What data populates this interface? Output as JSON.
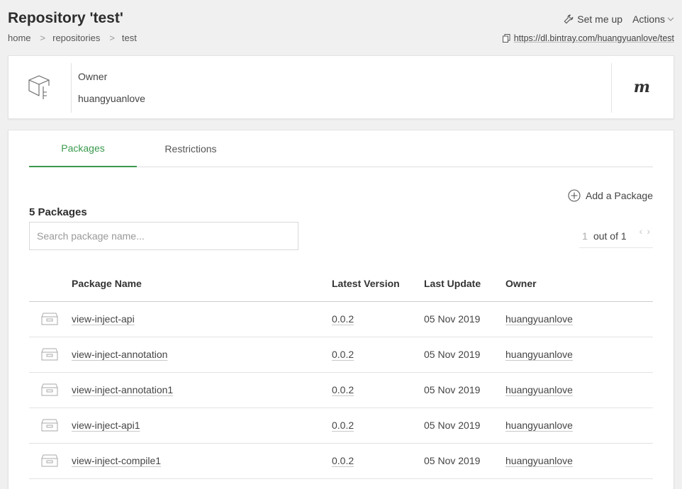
{
  "header": {
    "title": "Repository 'test'",
    "breadcrumb": [
      {
        "label": "home"
      },
      {
        "label": "repositories"
      },
      {
        "label": "test"
      }
    ],
    "breadcrumb_separator": ">",
    "set_me_up_label": "Set me up",
    "actions_label": "Actions",
    "repo_url": "https://dl.bintray.com/huangyuanlove/test"
  },
  "owner_card": {
    "owner_label": "Owner",
    "owner_name": "huangyuanlove",
    "repo_type_logo": "m"
  },
  "tabs": [
    {
      "label": "Packages",
      "active": true
    },
    {
      "label": "Restrictions",
      "active": false
    }
  ],
  "packages": {
    "add_label": "Add a Package",
    "count_label": "5 Packages",
    "search_placeholder": "Search package name...",
    "pager": {
      "current": "1",
      "out_of": "out of 1"
    },
    "columns": {
      "name": "Package Name",
      "version": "Latest Version",
      "updated": "Last Update",
      "owner": "Owner"
    },
    "rows": [
      {
        "name": "view-inject-api",
        "version": "0.0.2",
        "updated": "05 Nov 2019",
        "owner": "huangyuanlove"
      },
      {
        "name": "view-inject-annotation",
        "version": "0.0.2",
        "updated": "05 Nov 2019",
        "owner": "huangyuanlove"
      },
      {
        "name": "view-inject-annotation1",
        "version": "0.0.2",
        "updated": "05 Nov 2019",
        "owner": "huangyuanlove"
      },
      {
        "name": "view-inject-api1",
        "version": "0.0.2",
        "updated": "05 Nov 2019",
        "owner": "huangyuanlove"
      },
      {
        "name": "view-inject-compile1",
        "version": "0.0.2",
        "updated": "05 Nov 2019",
        "owner": "huangyuanlove"
      }
    ]
  },
  "colors": {
    "accent_green": "#3a9a4d",
    "background": "#f0f0f0"
  },
  "icons": {
    "set_me_up": "wrench-icon",
    "actions": "chevron-down-icon",
    "url": "copy-icon",
    "repo": "box-icon",
    "add": "plus-circle-icon",
    "package": "archive-box-icon",
    "pager_prev": "chevron-left-icon",
    "pager_next": "chevron-right-icon"
  }
}
